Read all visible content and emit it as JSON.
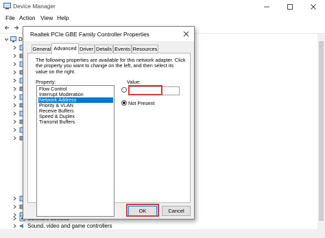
{
  "window": {
    "title": "Device Manager",
    "controls": [
      "minimize",
      "maximize",
      "close"
    ]
  },
  "menu": [
    "File",
    "Action",
    "View",
    "Help"
  ],
  "toolbar_icons": [
    "back-arrow-icon",
    "forward-arrow-icon",
    "properties-icon",
    "help-icon",
    "scan-icon",
    "monitor-icon",
    "uninstall-icon",
    "update-icon"
  ],
  "tree": {
    "root_label": "DES",
    "visible_bottom_items": [
      "Software devices",
      "Sound, video and game controllers"
    ]
  },
  "dialog": {
    "title": "Realtek PCIe GBE Family Controller Properties",
    "tabs": [
      "General",
      "Advanced",
      "Driver",
      "Details",
      "Events",
      "Resources"
    ],
    "active_tab": "Advanced",
    "description": "The following properties are available for this network adapter. Click the property you want to change on the left, and then select its value on the right.",
    "property_label": "Property:",
    "properties": [
      "Flow Control",
      "Interrupt Moderation",
      "Network Address",
      "Priority & VLAN",
      "Receive Buffers",
      "Speed & Duplex",
      "Transmit Buffers"
    ],
    "selected_property": "Network Address",
    "value_label": "Value:",
    "value_input": "",
    "not_present_label": "Not Present",
    "ok_label": "OK",
    "cancel_label": "Cancel"
  },
  "colors": {
    "selection": "#0078d7",
    "highlight_box": "#d9393b",
    "dialog_bg": "#f0f0f0"
  }
}
